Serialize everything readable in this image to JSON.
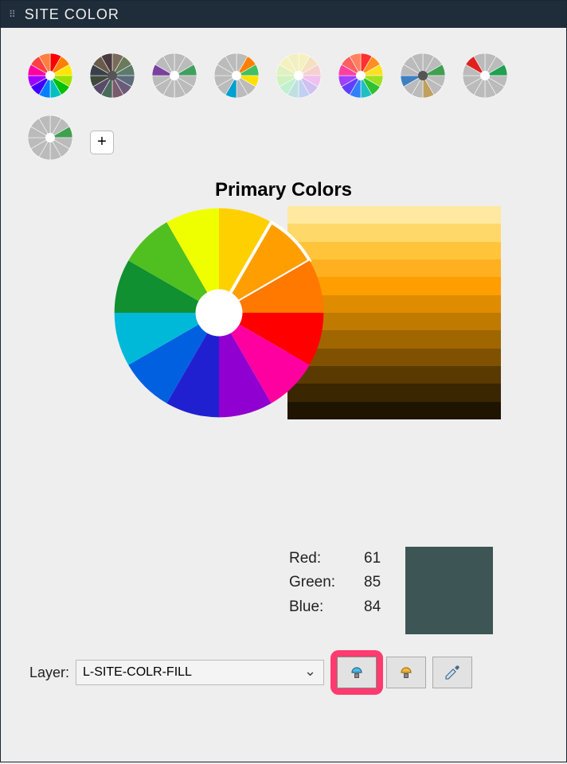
{
  "window": {
    "title": "SITE COLOR"
  },
  "palettes": [
    {
      "name": "rainbow",
      "colors": [
        "#ff0000",
        "#ff8000",
        "#ffe600",
        "#a0e000",
        "#00c000",
        "#00c0c0",
        "#0080ff",
        "#4000ff",
        "#a000ff",
        "#ff00a0",
        "#ff4040",
        "#ff8040"
      ],
      "hub": "#fff"
    },
    {
      "name": "muted",
      "colors": [
        "#7a6b5b",
        "#6b7a5b",
        "#5b7a6b",
        "#5b6b7a",
        "#6b5b7a",
        "#7a5b6b",
        "#4a6a5a",
        "#5a4a6a",
        "#404a3a",
        "#3a404a",
        "#6a5a4a",
        "#4a3a40"
      ],
      "hub": "#555"
    },
    {
      "name": "grey-green-violet",
      "colors": [
        "#bbb",
        "#bbb",
        "#40a060",
        "#bbb",
        "#bbb",
        "#bbb",
        "#bbb",
        "#bbb",
        "#bbb",
        "#7a40a0",
        "#bbb",
        "#bbb"
      ],
      "hub": "#fff"
    },
    {
      "name": "multi",
      "colors": [
        "#bbb",
        "#ff8000",
        "#40c060",
        "#ffe000",
        "#bbb",
        "#bbb",
        "#00a0d0",
        "#bbb",
        "#bbb",
        "#bbb",
        "#bbb",
        "#bbb"
      ],
      "hub": "#fff"
    },
    {
      "name": "pastel",
      "colors": [
        "#f5f0c0",
        "#f5e0c0",
        "#f5d0d0",
        "#f0c0f0",
        "#d0c0f0",
        "#c0d0f0",
        "#c0e0e0",
        "#c0f0d0",
        "#d0f0c0",
        "#e0f0c0",
        "#f5f0c0",
        "#f0f0c0"
      ],
      "hub": "#fff"
    },
    {
      "name": "vibrant",
      "colors": [
        "#ff3030",
        "#ff9020",
        "#ffe020",
        "#a0e020",
        "#30c030",
        "#20c0c0",
        "#3080ff",
        "#6040ff",
        "#a040ff",
        "#ff40a0",
        "#ff6060",
        "#ff8060"
      ],
      "hub": "#fff"
    },
    {
      "name": "tri-blue-tan-green",
      "colors": [
        "#bbb",
        "#bbb",
        "#40a050",
        "#bbb",
        "#bbb",
        "#c0a060",
        "#bbb",
        "#bbb",
        "#4080c0",
        "#bbb",
        "#bbb",
        "#bbb"
      ],
      "hub": "#555"
    },
    {
      "name": "rgg",
      "colors": [
        "#bbb",
        "#bbb",
        "#20a050",
        "#bbb",
        "#bbb",
        "#bbb",
        "#bbb",
        "#bbb",
        "#bbb",
        "#bbb",
        "#e02020",
        "#bbb"
      ],
      "hub": "#fff"
    },
    {
      "name": "single-green",
      "colors": [
        "#bbb",
        "#bbb",
        "#40a050",
        "#bbb",
        "#bbb",
        "#bbb",
        "#bbb",
        "#bbb",
        "#bbb",
        "#bbb",
        "#bbb",
        "#bbb"
      ],
      "hub": "#fff"
    },
    {
      "name": "add",
      "add": true
    }
  ],
  "section_title": "Primary Colors",
  "wheel": {
    "colors": [
      "#ffd000",
      "#ff9e00",
      "#ff7800",
      "#ff0000",
      "#ff00a0",
      "#9000d0",
      "#2020d0",
      "#0060e0",
      "#00b8d8",
      "#109030",
      "#50c020",
      "#f0ff00"
    ],
    "selected_index": 1,
    "hub": "#ffffff"
  },
  "shades": [
    "#ffe9a0",
    "#ffd86a",
    "#ffc43a",
    "#ffb020",
    "#ff9e00",
    "#e08c00",
    "#c07a00",
    "#a06600",
    "#805200",
    "#5a3a00",
    "#3a2600",
    "#1e1400"
  ],
  "rgb": {
    "labels": {
      "r": "Red:",
      "g": "Green:",
      "b": "Blue:"
    },
    "values": {
      "r": "61",
      "g": "85",
      "b": "84"
    }
  },
  "swatch_color": "#3d5554",
  "layer": {
    "label": "Layer:",
    "selected": "L-SITE-COLR-FILL"
  },
  "tools": {
    "lamp1_name": "lamp-blue-icon",
    "lamp2_name": "lamp-orange-icon",
    "eyedropper": "eyedropper-icon"
  }
}
